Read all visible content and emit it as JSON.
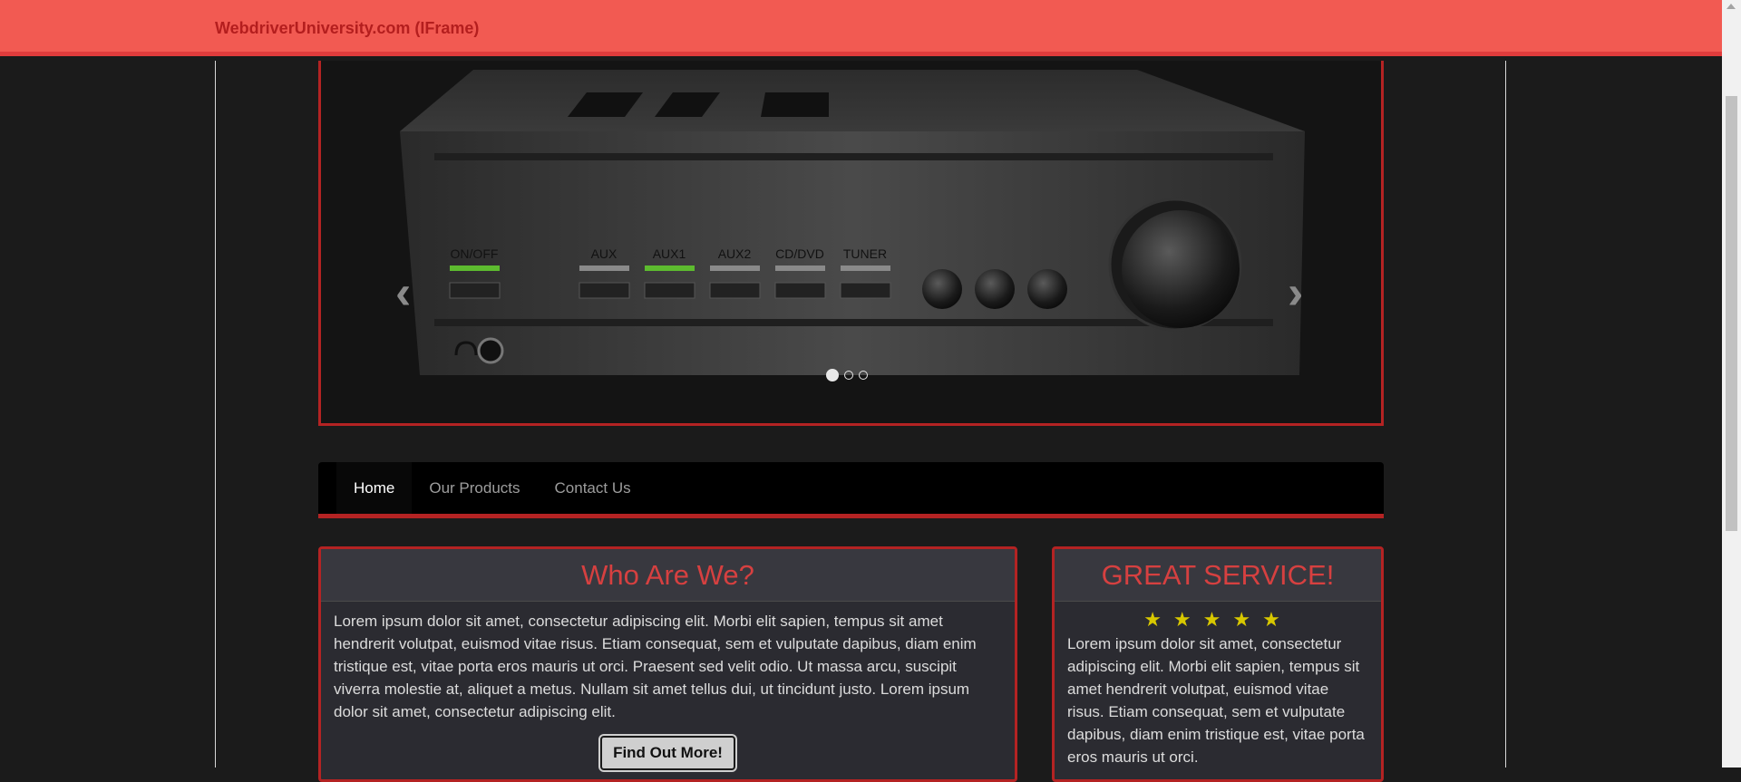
{
  "header": {
    "brand": "WebdriverUniversity.com (IFrame)"
  },
  "carousel": {
    "prev_icon": "chevron-left-icon",
    "next_icon": "chevron-right-icon",
    "amp_labels": [
      "ON/OFF",
      "AUX",
      "AUX1",
      "AUX2",
      "CD/DVD",
      "TUNER"
    ],
    "slides_count": 3,
    "active_slide": 0
  },
  "nav": {
    "items": [
      {
        "label": "Home",
        "active": true
      },
      {
        "label": "Our Products",
        "active": false
      },
      {
        "label": "Contact Us",
        "active": false
      }
    ]
  },
  "who_are_we": {
    "title": "Who Are We?",
    "text": "Lorem ipsum dolor sit amet, consectetur adipiscing elit. Morbi elit sapien, tempus sit amet hendrerit volutpat, euismod vitae risus. Etiam consequat, sem et vulputate dapibus, diam enim tristique est, vitae porta eros mauris ut orci. Praesent sed velit odio. Ut massa arcu, suscipit viverra molestie at, aliquet a metus. Nullam sit amet tellus dui, ut tincidunt justo. Lorem ipsum dolor sit amet, consectetur adipiscing elit.",
    "button_label": "Find Out More!"
  },
  "great_service": {
    "title": "GREAT SERVICE!",
    "stars": "★★★★★",
    "rating": 5,
    "text": "Lorem ipsum dolor sit amet, consectetur adipiscing elit. Morbi elit sapien, tempus sit amet hendrerit volutpat, euismod vitae risus. Etiam consequat, sem et vulputate dapibus, diam enim tristique est, vitae porta eros mauris ut orci."
  },
  "colors": {
    "header_bg": "#f25a52",
    "accent_red": "#b42323",
    "title_red": "#d64040",
    "star_yellow": "#d8c800",
    "led_green": "#5dbb2f"
  }
}
